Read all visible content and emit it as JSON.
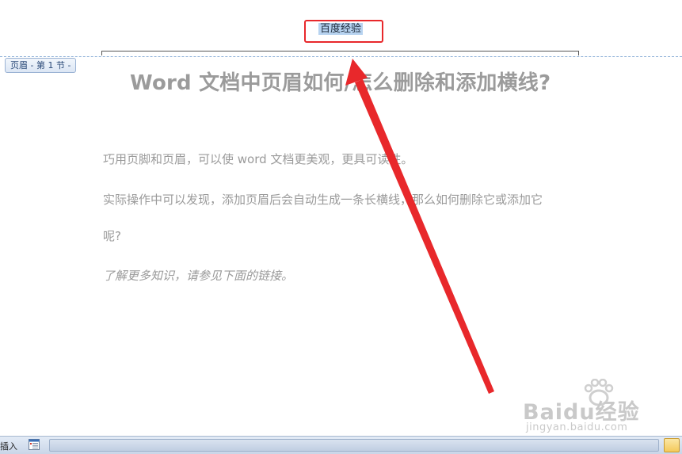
{
  "header": {
    "text": "百度经验",
    "section_tag": "页眉 - 第 1 节 -"
  },
  "document": {
    "title": "Word 文档中页眉如何/怎么删除和添加横线?",
    "paragraphs": [
      "巧用页脚和页眉，可以使 word 文档更美观，更具可读性。",
      "实际操作中可以发现，添加页眉后会自动生成一条长横线，那么如何删除它或添加它",
      "呢?",
      "了解更多知识，请参见下面的链接。"
    ]
  },
  "watermark": {
    "brand": "Baidu经验",
    "url": "jingyan.baidu.com"
  },
  "statusbar": {
    "mode": "插入"
  },
  "colors": {
    "annotation_red": "#e8282b",
    "selection_blue": "#b7d3f0",
    "header_dash": "#8db0d8"
  }
}
